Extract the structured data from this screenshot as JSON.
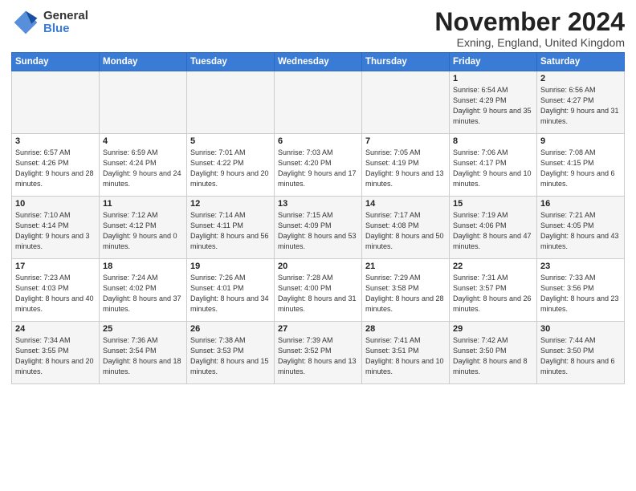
{
  "logo": {
    "general": "General",
    "blue": "Blue"
  },
  "title": "November 2024",
  "subtitle": "Exning, England, United Kingdom",
  "days_of_week": [
    "Sunday",
    "Monday",
    "Tuesday",
    "Wednesday",
    "Thursday",
    "Friday",
    "Saturday"
  ],
  "weeks": [
    [
      {
        "day": "",
        "info": ""
      },
      {
        "day": "",
        "info": ""
      },
      {
        "day": "",
        "info": ""
      },
      {
        "day": "",
        "info": ""
      },
      {
        "day": "",
        "info": ""
      },
      {
        "day": "1",
        "info": "Sunrise: 6:54 AM\nSunset: 4:29 PM\nDaylight: 9 hours and 35 minutes."
      },
      {
        "day": "2",
        "info": "Sunrise: 6:56 AM\nSunset: 4:27 PM\nDaylight: 9 hours and 31 minutes."
      }
    ],
    [
      {
        "day": "3",
        "info": "Sunrise: 6:57 AM\nSunset: 4:26 PM\nDaylight: 9 hours and 28 minutes."
      },
      {
        "day": "4",
        "info": "Sunrise: 6:59 AM\nSunset: 4:24 PM\nDaylight: 9 hours and 24 minutes."
      },
      {
        "day": "5",
        "info": "Sunrise: 7:01 AM\nSunset: 4:22 PM\nDaylight: 9 hours and 20 minutes."
      },
      {
        "day": "6",
        "info": "Sunrise: 7:03 AM\nSunset: 4:20 PM\nDaylight: 9 hours and 17 minutes."
      },
      {
        "day": "7",
        "info": "Sunrise: 7:05 AM\nSunset: 4:19 PM\nDaylight: 9 hours and 13 minutes."
      },
      {
        "day": "8",
        "info": "Sunrise: 7:06 AM\nSunset: 4:17 PM\nDaylight: 9 hours and 10 minutes."
      },
      {
        "day": "9",
        "info": "Sunrise: 7:08 AM\nSunset: 4:15 PM\nDaylight: 9 hours and 6 minutes."
      }
    ],
    [
      {
        "day": "10",
        "info": "Sunrise: 7:10 AM\nSunset: 4:14 PM\nDaylight: 9 hours and 3 minutes."
      },
      {
        "day": "11",
        "info": "Sunrise: 7:12 AM\nSunset: 4:12 PM\nDaylight: 9 hours and 0 minutes."
      },
      {
        "day": "12",
        "info": "Sunrise: 7:14 AM\nSunset: 4:11 PM\nDaylight: 8 hours and 56 minutes."
      },
      {
        "day": "13",
        "info": "Sunrise: 7:15 AM\nSunset: 4:09 PM\nDaylight: 8 hours and 53 minutes."
      },
      {
        "day": "14",
        "info": "Sunrise: 7:17 AM\nSunset: 4:08 PM\nDaylight: 8 hours and 50 minutes."
      },
      {
        "day": "15",
        "info": "Sunrise: 7:19 AM\nSunset: 4:06 PM\nDaylight: 8 hours and 47 minutes."
      },
      {
        "day": "16",
        "info": "Sunrise: 7:21 AM\nSunset: 4:05 PM\nDaylight: 8 hours and 43 minutes."
      }
    ],
    [
      {
        "day": "17",
        "info": "Sunrise: 7:23 AM\nSunset: 4:03 PM\nDaylight: 8 hours and 40 minutes."
      },
      {
        "day": "18",
        "info": "Sunrise: 7:24 AM\nSunset: 4:02 PM\nDaylight: 8 hours and 37 minutes."
      },
      {
        "day": "19",
        "info": "Sunrise: 7:26 AM\nSunset: 4:01 PM\nDaylight: 8 hours and 34 minutes."
      },
      {
        "day": "20",
        "info": "Sunrise: 7:28 AM\nSunset: 4:00 PM\nDaylight: 8 hours and 31 minutes."
      },
      {
        "day": "21",
        "info": "Sunrise: 7:29 AM\nSunset: 3:58 PM\nDaylight: 8 hours and 28 minutes."
      },
      {
        "day": "22",
        "info": "Sunrise: 7:31 AM\nSunset: 3:57 PM\nDaylight: 8 hours and 26 minutes."
      },
      {
        "day": "23",
        "info": "Sunrise: 7:33 AM\nSunset: 3:56 PM\nDaylight: 8 hours and 23 minutes."
      }
    ],
    [
      {
        "day": "24",
        "info": "Sunrise: 7:34 AM\nSunset: 3:55 PM\nDaylight: 8 hours and 20 minutes."
      },
      {
        "day": "25",
        "info": "Sunrise: 7:36 AM\nSunset: 3:54 PM\nDaylight: 8 hours and 18 minutes."
      },
      {
        "day": "26",
        "info": "Sunrise: 7:38 AM\nSunset: 3:53 PM\nDaylight: 8 hours and 15 minutes."
      },
      {
        "day": "27",
        "info": "Sunrise: 7:39 AM\nSunset: 3:52 PM\nDaylight: 8 hours and 13 minutes."
      },
      {
        "day": "28",
        "info": "Sunrise: 7:41 AM\nSunset: 3:51 PM\nDaylight: 8 hours and 10 minutes."
      },
      {
        "day": "29",
        "info": "Sunrise: 7:42 AM\nSunset: 3:50 PM\nDaylight: 8 hours and 8 minutes."
      },
      {
        "day": "30",
        "info": "Sunrise: 7:44 AM\nSunset: 3:50 PM\nDaylight: 8 hours and 6 minutes."
      }
    ]
  ]
}
